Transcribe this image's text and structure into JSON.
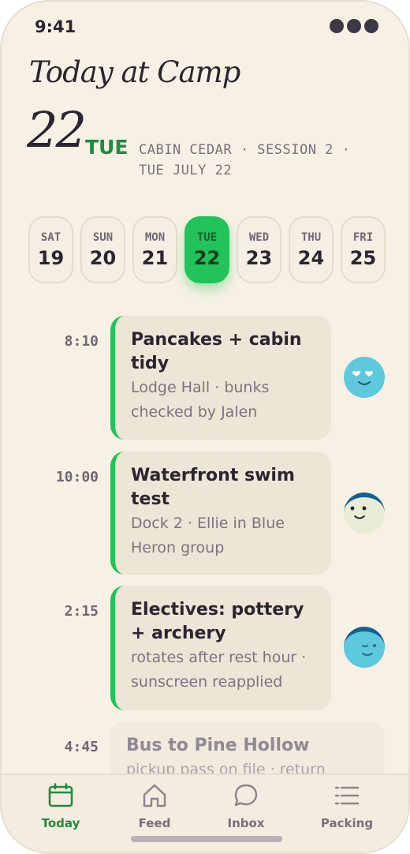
{
  "status": {
    "time": "9:41"
  },
  "header": {
    "title": "Today at Camp",
    "day_number": "22",
    "day_of_week": "TUE",
    "cabin_info": "CABIN CEDAR · SESSION 2 · TUE JULY 22"
  },
  "week": [
    {
      "name": "SAT",
      "num": "19",
      "selected": false
    },
    {
      "name": "SUN",
      "num": "20",
      "selected": false
    },
    {
      "name": "MON",
      "num": "21",
      "selected": false
    },
    {
      "name": "TUE",
      "num": "22",
      "selected": true
    },
    {
      "name": "WED",
      "num": "23",
      "selected": false
    },
    {
      "name": "THU",
      "num": "24",
      "selected": false
    },
    {
      "name": "FRI",
      "num": "25",
      "selected": false
    }
  ],
  "events": [
    {
      "time": "8:10",
      "title": "Pancakes + cabin tidy",
      "detail": "Lodge Hall · bunks checked by Jalen",
      "avatar": "heart-eyes-face-icon"
    },
    {
      "time": "10:00",
      "title": "Waterfront swim test",
      "detail": "Dock 2 · Ellie in Blue Heron group",
      "avatar": "smiling-face-with-hat-icon"
    },
    {
      "time": "2:15",
      "title": "Electives: pottery + archery",
      "detail": "rotates after rest hour · sunscreen reapplied",
      "avatar": "winking-face-with-hat-icon"
    },
    {
      "time": "4:45",
      "title": "Bus to Pine Hollow",
      "detail": "pickup pass on file · return"
    }
  ],
  "tabs": [
    {
      "label": "Today",
      "icon": "calendar-icon",
      "active": true
    },
    {
      "label": "Feed",
      "icon": "home-icon",
      "active": false
    },
    {
      "label": "Inbox",
      "icon": "chat-bubble-icon",
      "active": false
    },
    {
      "label": "Packing",
      "icon": "list-icon",
      "active": false
    }
  ],
  "colors": {
    "accent": "#21c35a",
    "accent_text": "#1f8b3f",
    "background": "#f7f1e5",
    "card": "#ede5d6"
  }
}
